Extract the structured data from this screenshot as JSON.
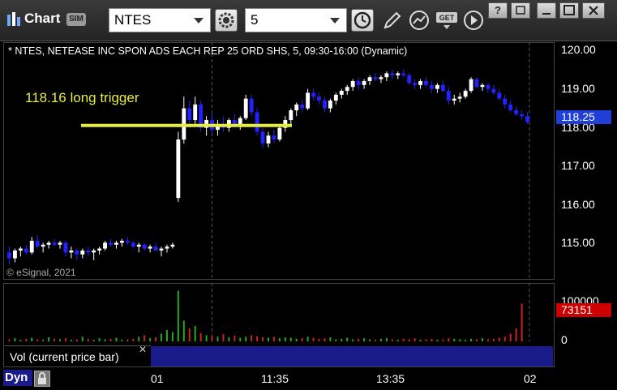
{
  "toolbar": {
    "app_title": "Chart",
    "sim_badge": "SIM",
    "symbol_value": "NTES",
    "interval_value": "5",
    "icons": [
      "settings-icon",
      "clock-icon",
      "pencil-icon",
      "study-icon",
      "get-icon",
      "play-icon"
    ],
    "window_buttons": [
      "?",
      "restore",
      "minimize",
      "maximize",
      "close"
    ]
  },
  "chart": {
    "symbol_description": "* NTES, NETEASE INC SPON ADS EACH REP 25 ORD SHS, 5, 09:30-16:00 (Dynamic)",
    "annotation_text": "118.16 long trigger",
    "copyright": "© eSignal, 2021",
    "price_axis_labels": [
      "120.00",
      "119.00",
      "118.00",
      "117.00",
      "116.00",
      "115.00"
    ],
    "current_price_tag": "118.25",
    "volume_axis_labels": [
      "100000",
      "0"
    ],
    "current_volume_tag": "73151",
    "volume_study_label": "Vol (current price bar)",
    "time_labels": [
      "01",
      "11:35",
      "13:35",
      "02"
    ],
    "mode_label": "Dyn",
    "colors": {
      "up": "#ffffff",
      "down": "#2222ff",
      "trigger_line": "#e6ee3c",
      "price_tag": "#1f3fd8",
      "volume_tag": "#cc0000",
      "vol_up": "#22aa22",
      "vol_down": "#cc2222"
    }
  },
  "chart_data": {
    "type": "candlestick",
    "ylim": [
      114.2,
      120.3
    ],
    "trigger_level": 118.16,
    "session_break_index": 37,
    "bars": [
      [
        114.9,
        115.05,
        114.6,
        114.75
      ],
      [
        114.75,
        115.0,
        114.65,
        114.95
      ],
      [
        114.95,
        115.05,
        114.8,
        115.0
      ],
      [
        115.0,
        115.1,
        114.85,
        114.9
      ],
      [
        114.9,
        115.3,
        114.85,
        115.2
      ],
      [
        115.2,
        115.35,
        115.0,
        115.05
      ],
      [
        115.05,
        115.15,
        114.9,
        115.1
      ],
      [
        115.1,
        115.2,
        115.0,
        115.15
      ],
      [
        115.15,
        115.25,
        115.05,
        115.1
      ],
      [
        115.1,
        115.2,
        115.0,
        115.15
      ],
      [
        115.15,
        115.2,
        114.8,
        114.9
      ],
      [
        114.9,
        115.05,
        114.75,
        114.95
      ],
      [
        114.95,
        115.0,
        114.7,
        114.85
      ],
      [
        114.85,
        115.0,
        114.75,
        114.95
      ],
      [
        114.95,
        115.05,
        114.8,
        114.9
      ],
      [
        114.9,
        115.0,
        114.7,
        114.95
      ],
      [
        114.95,
        115.05,
        114.85,
        115.0
      ],
      [
        115.0,
        115.2,
        114.95,
        115.15
      ],
      [
        115.15,
        115.25,
        115.05,
        115.1
      ],
      [
        115.1,
        115.2,
        115.0,
        115.15
      ],
      [
        115.15,
        115.25,
        115.05,
        115.2
      ],
      [
        115.2,
        115.3,
        115.1,
        115.15
      ],
      [
        115.15,
        115.2,
        115.0,
        115.05
      ],
      [
        115.05,
        115.15,
        114.9,
        115.1
      ],
      [
        115.1,
        115.15,
        114.95,
        115.0
      ],
      [
        115.0,
        115.1,
        114.9,
        115.05
      ],
      [
        115.05,
        115.15,
        114.95,
        114.95
      ],
      [
        114.95,
        115.05,
        114.8,
        115.0
      ],
      [
        115.0,
        115.1,
        114.9,
        115.05
      ],
      [
        115.05,
        115.15,
        115.0,
        115.1
      ],
      [
        116.3,
        118.0,
        116.2,
        117.8
      ],
      [
        117.8,
        118.9,
        117.7,
        118.6
      ],
      [
        118.6,
        118.8,
        118.1,
        118.3
      ],
      [
        118.3,
        118.9,
        118.2,
        118.7
      ],
      [
        118.7,
        118.8,
        118.0,
        118.1
      ],
      [
        118.1,
        118.4,
        117.9,
        118.3
      ],
      [
        118.3,
        118.5,
        117.95,
        118.05
      ],
      [
        118.05,
        118.3,
        117.9,
        118.2
      ],
      [
        118.2,
        118.4,
        118.0,
        118.1
      ],
      [
        118.1,
        118.35,
        118.0,
        118.3
      ],
      [
        118.3,
        118.45,
        118.1,
        118.2
      ],
      [
        118.2,
        118.4,
        118.05,
        118.35
      ],
      [
        118.35,
        118.95,
        118.3,
        118.85
      ],
      [
        118.85,
        118.95,
        118.4,
        118.5
      ],
      [
        118.5,
        118.6,
        117.9,
        118.0
      ],
      [
        118.0,
        118.1,
        117.6,
        117.7
      ],
      [
        117.7,
        118.0,
        117.6,
        117.9
      ],
      [
        117.9,
        118.05,
        117.7,
        117.8
      ],
      [
        117.8,
        118.2,
        117.75,
        118.1
      ],
      [
        118.1,
        118.4,
        118.0,
        118.3
      ],
      [
        118.3,
        118.6,
        118.2,
        118.55
      ],
      [
        118.55,
        118.75,
        118.4,
        118.7
      ],
      [
        118.7,
        118.8,
        118.5,
        118.6
      ],
      [
        118.6,
        119.1,
        118.55,
        119.0
      ],
      [
        119.0,
        119.1,
        118.8,
        118.9
      ],
      [
        118.9,
        119.0,
        118.7,
        118.8
      ],
      [
        118.8,
        118.9,
        118.5,
        118.6
      ],
      [
        118.6,
        118.85,
        118.5,
        118.8
      ],
      [
        118.8,
        119.0,
        118.7,
        118.95
      ],
      [
        118.95,
        119.1,
        118.85,
        119.05
      ],
      [
        119.05,
        119.2,
        118.95,
        119.15
      ],
      [
        119.15,
        119.35,
        119.05,
        119.3
      ],
      [
        119.3,
        119.4,
        119.1,
        119.2
      ],
      [
        119.2,
        119.35,
        119.1,
        119.3
      ],
      [
        119.3,
        119.45,
        119.2,
        119.4
      ],
      [
        119.4,
        119.5,
        119.3,
        119.35
      ],
      [
        119.35,
        119.45,
        119.25,
        119.4
      ],
      [
        119.4,
        119.55,
        119.3,
        119.5
      ],
      [
        119.5,
        119.6,
        119.35,
        119.45
      ],
      [
        119.45,
        119.55,
        119.35,
        119.5
      ],
      [
        119.5,
        119.6,
        119.4,
        119.45
      ],
      [
        119.45,
        119.5,
        119.2,
        119.25
      ],
      [
        119.25,
        119.35,
        119.1,
        119.2
      ],
      [
        119.2,
        119.35,
        119.1,
        119.3
      ],
      [
        119.3,
        119.4,
        119.15,
        119.2
      ],
      [
        119.2,
        119.3,
        119.0,
        119.1
      ],
      [
        119.1,
        119.25,
        119.0,
        119.2
      ],
      [
        119.2,
        119.3,
        119.0,
        119.05
      ],
      [
        119.05,
        119.15,
        118.7,
        118.8
      ],
      [
        118.8,
        118.95,
        118.7,
        118.85
      ],
      [
        118.85,
        119.0,
        118.75,
        118.9
      ],
      [
        118.9,
        119.1,
        118.85,
        119.05
      ],
      [
        119.05,
        119.4,
        119.0,
        119.35
      ],
      [
        119.35,
        119.4,
        119.1,
        119.15
      ],
      [
        119.15,
        119.25,
        119.05,
        119.2
      ],
      [
        119.2,
        119.25,
        119.0,
        119.1
      ],
      [
        119.1,
        119.2,
        118.95,
        119.0
      ],
      [
        119.0,
        119.1,
        118.8,
        118.85
      ],
      [
        118.85,
        118.95,
        118.6,
        118.7
      ],
      [
        118.7,
        118.8,
        118.5,
        118.55
      ],
      [
        118.55,
        118.65,
        118.4,
        118.45
      ],
      [
        118.45,
        118.55,
        118.3,
        118.4
      ],
      [
        118.4,
        118.5,
        118.2,
        118.25
      ]
    ],
    "volumes": [
      4000,
      6000,
      3000,
      5000,
      7000,
      4000,
      3000,
      8000,
      5000,
      4000,
      6000,
      3000,
      4000,
      9000,
      5000,
      3000,
      6000,
      4000,
      5000,
      7000,
      3000,
      4000,
      5000,
      9000,
      12000,
      6000,
      8000,
      15000,
      22000,
      18000,
      98000,
      40000,
      25000,
      30000,
      16000,
      12000,
      10000,
      9000,
      14000,
      8000,
      11000,
      7000,
      9000,
      12000,
      10000,
      8000,
      7000,
      9000,
      6000,
      8000,
      7000,
      5000,
      6000,
      9000,
      7000,
      5000,
      6000,
      8000,
      4000,
      5000,
      7000,
      4000,
      5000,
      6000,
      4000,
      3000,
      5000,
      6000,
      4000,
      3000,
      5000,
      4000,
      6000,
      3000,
      4000,
      5000,
      3000,
      4000,
      6000,
      5000,
      4000,
      3000,
      5000,
      4000,
      6000,
      4000,
      5000,
      7000,
      9000,
      15000,
      25000,
      73151
    ],
    "vol_ylim": [
      0,
      110000
    ]
  }
}
